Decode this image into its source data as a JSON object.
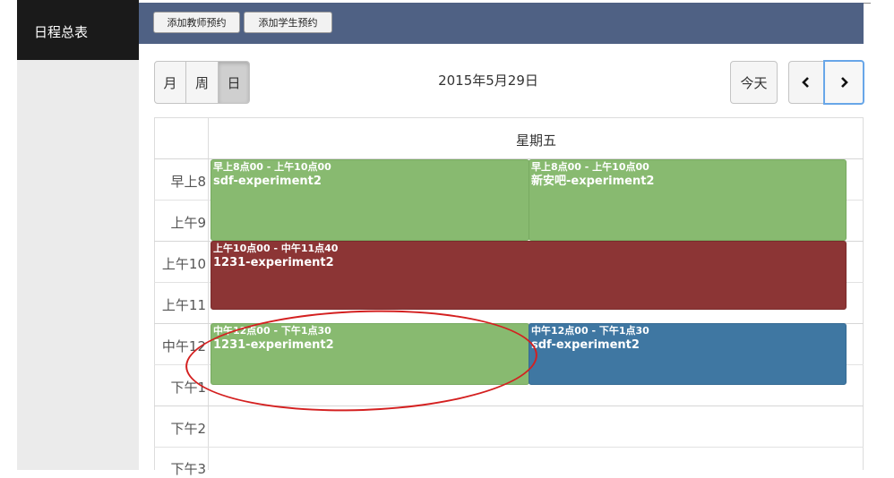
{
  "sidebar": {
    "title": "日程总表"
  },
  "topbar": {
    "add_teacher": "添加教师预约",
    "add_student": "添加学生预约"
  },
  "toolbar": {
    "views": [
      "月",
      "周",
      "日"
    ],
    "active_view": "日",
    "date_title": "2015年5月29日",
    "today": "今天",
    "prev_icon": "chevron-left-icon",
    "next_icon": "chevron-right-icon"
  },
  "calendar": {
    "day_header": "星期五",
    "time_labels": [
      "早上8",
      "上午9",
      "上午10",
      "上午11",
      "中午12",
      "下午1",
      "下午2",
      "下午3"
    ],
    "events": [
      {
        "time": "早上8点00 - 上午10点00",
        "title": "sdf-experiment2",
        "color": "#88ba70"
      },
      {
        "time": "早上8点00 - 上午10点00",
        "title": "新安吧-experiment2",
        "color": "#88ba70"
      },
      {
        "time": "上午10点00 - 中午11点40",
        "title": "1231-experiment2",
        "color": "#8c3535"
      },
      {
        "time": "中午12点00 - 下午1点30",
        "title": "1231-experiment2",
        "color": "#88ba70"
      },
      {
        "time": "中午12点00 - 下午1点30",
        "title": "sdf-experiment2",
        "color": "#3f77a2"
      }
    ]
  }
}
